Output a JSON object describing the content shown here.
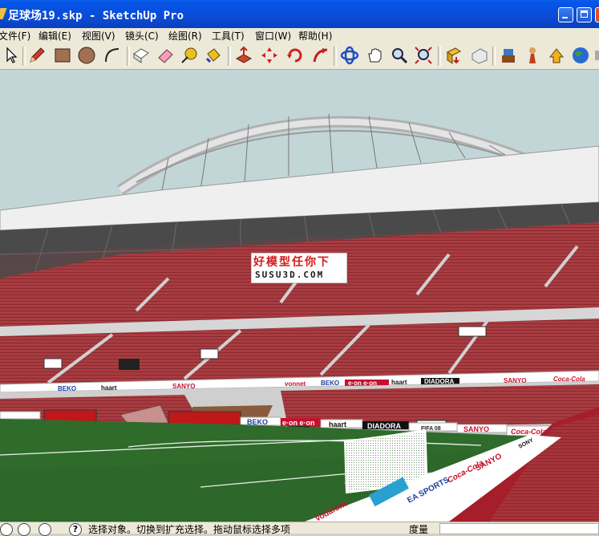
{
  "window": {
    "title": "足球场19.skp - SketchUp Pro"
  },
  "menu": {
    "items": [
      "文件(F)",
      "编辑(E)",
      "视图(V)",
      "镜头(C)",
      "绘图(R)",
      "工具(T)",
      "窗口(W)",
      "帮助(H)"
    ]
  },
  "toolbar": {
    "tools": [
      "select-icon",
      "pencil-icon",
      "rectangle-icon",
      "circle-icon",
      "arc-icon",
      "make-component-icon",
      "eraser-icon",
      "tape-measure-icon",
      "paint-bucket-icon",
      "push-pull-icon",
      "move-icon",
      "rotate-icon",
      "follow-me-icon",
      "orbit-icon",
      "pan-icon",
      "zoom-icon",
      "zoom-extents-icon",
      "get-models-icon",
      "share-model-icon",
      "components-icon",
      "add-location-icon",
      "upload-icon",
      "google-earth-icon",
      "extra-tool-icon"
    ]
  },
  "viewport": {
    "watermark_line1": "好模型任你下",
    "watermark_line2": "SUSU3D.COM",
    "ads": [
      "haart",
      "SANYO",
      "BEKO",
      "e·on e·on",
      "DIADORA",
      "Coca-Cola",
      "FIFA 08",
      "SONY",
      "EA SPORTS",
      "vonnet",
      "Vodafone",
      "haart",
      "SANYO",
      "BEKO",
      "e·on e·on",
      "DIADORA",
      "Coca-Cola"
    ]
  },
  "statusbar": {
    "hint_text": "选择对象。切换到扩充选择。拖动鼠标选择多项",
    "measurement_label": "度量",
    "measurement_value": ""
  },
  "colors": {
    "titlebar": "#0a4cd6",
    "seats": "#a83a3f",
    "grass": "#2e6b2a",
    "sky": "#c3d6d7",
    "ui_face": "#ece9d8"
  }
}
